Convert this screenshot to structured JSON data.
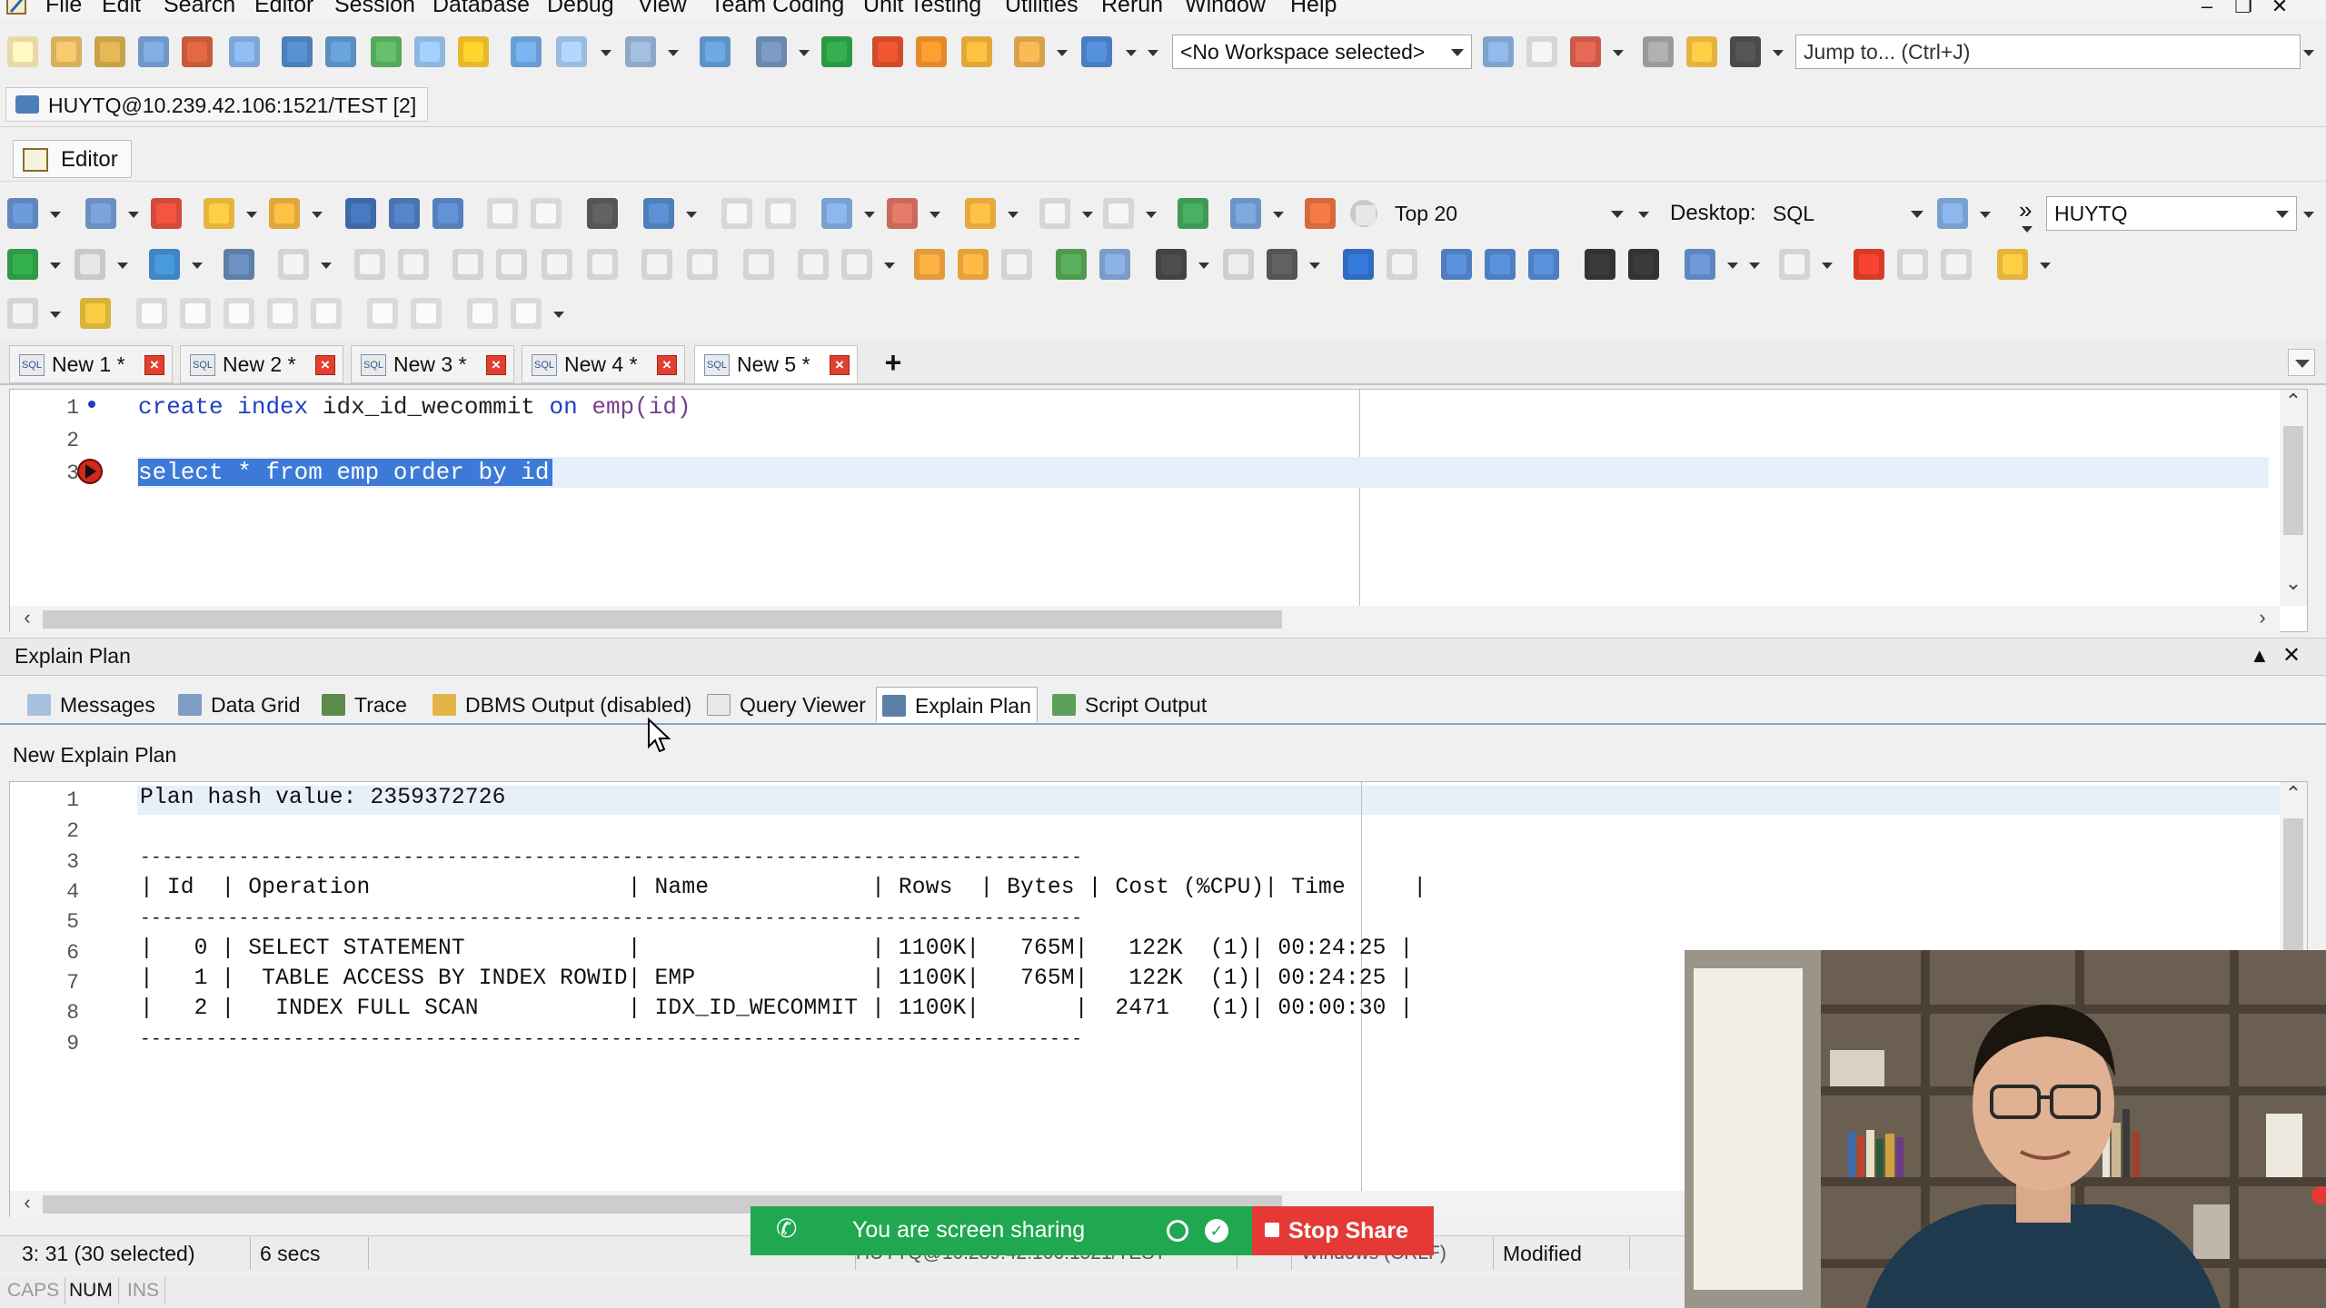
{
  "menu": [
    "File",
    "Edit",
    "Search",
    "Editor",
    "Session",
    "Database",
    "Debug",
    "View",
    "Team Coding",
    "Unit Testing",
    "Utilities",
    "Rerun",
    "Window",
    "Help"
  ],
  "toolbar1": {
    "workspace": "<No Workspace selected>",
    "jump_placeholder": "Jump to... (Ctrl+J)"
  },
  "connection_tab": "HUYTQ@10.239.42.106:1521/TEST [2]",
  "editor_button": "Editor",
  "toolbar2": {
    "top_label": "Top 20",
    "desktop_label": "Desktop:",
    "desktop_value": "SQL",
    "schema_value": "HUYTQ"
  },
  "doc_tabs": [
    {
      "label": "New 1 *",
      "active": false
    },
    {
      "label": "New 2 *",
      "active": false
    },
    {
      "label": "New 3 *",
      "active": false
    },
    {
      "label": "New 4 *",
      "active": false
    },
    {
      "label": "New 5 *",
      "active": true
    }
  ],
  "editor": {
    "line_numbers": [
      "1",
      "2",
      "3"
    ],
    "line1": {
      "kw1": "create",
      "kw2": "index",
      "name": "idx_id_wecommit",
      "kw3": "on",
      "table": "emp(id)"
    },
    "line3": "select * from emp order by id"
  },
  "explain_panel_title": "Explain Plan",
  "result_tabs": [
    {
      "label": "Messages",
      "active": false
    },
    {
      "label": "Data Grid",
      "active": false
    },
    {
      "label": "Trace",
      "active": false
    },
    {
      "label": "DBMS Output (disabled)",
      "active": false
    },
    {
      "label": "Query Viewer",
      "active": false
    },
    {
      "label": "Explain Plan",
      "active": true
    },
    {
      "label": "Script Output",
      "active": false
    }
  ],
  "new_explain_plan": "New Explain Plan",
  "plan_output": {
    "line_numbers": [
      "1",
      "2",
      "3",
      "4",
      "5",
      "6",
      "7",
      "8",
      "9"
    ],
    "lines": [
      "Plan hash value: 2359372726",
      "",
      "--------------------------------------------------------------------------------------",
      "| Id  | Operation                   | Name            | Rows  | Bytes | Cost (%CPU)| Time     |",
      "--------------------------------------------------------------------------------------",
      "|   0 | SELECT STATEMENT            |                 | 1100K|   765M|   122K  (1)| 00:24:25 |",
      "|   1 |  TABLE ACCESS BY INDEX ROWID| EMP             | 1100K|   765M|   122K  (1)| 00:24:25 |",
      "|   2 |   INDEX FULL SCAN           | IDX_ID_WECOMMIT | 1100K|       |  2471   (1)| 00:00:30 |",
      "--------------------------------------------------------------------------------------"
    ]
  },
  "status": {
    "position": "3: 31 (30 selected)",
    "elapsed": "6 secs",
    "connection": "HUYTQ@10.239.42.106:1521/TEST",
    "line_ending": "Windows (CRLF)",
    "modified": "Modified"
  },
  "keys": [
    "CAPS",
    "NUM",
    "INS"
  ],
  "share": {
    "message": "You are screen sharing",
    "stop": "Stop Share"
  },
  "colors": {
    "keyword": "#1f3fbf",
    "selection": "#cfe2f7",
    "share_green": "#1fa84f",
    "stop_red": "#e53935"
  }
}
